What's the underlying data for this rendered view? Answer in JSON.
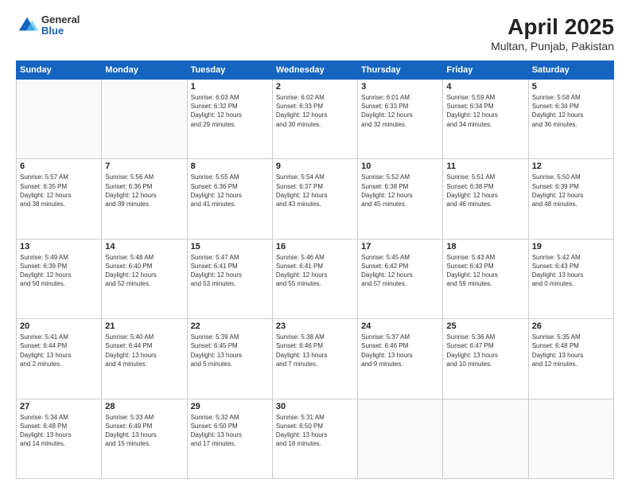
{
  "header": {
    "logo_general": "General",
    "logo_blue": "Blue",
    "title": "April 2025",
    "subtitle": "Multan, Punjab, Pakistan"
  },
  "calendar": {
    "days_of_week": [
      "Sunday",
      "Monday",
      "Tuesday",
      "Wednesday",
      "Thursday",
      "Friday",
      "Saturday"
    ],
    "weeks": [
      [
        {
          "day": "",
          "info": ""
        },
        {
          "day": "",
          "info": ""
        },
        {
          "day": "1",
          "info": "Sunrise: 6:03 AM\nSunset: 6:32 PM\nDaylight: 12 hours\nand 29 minutes."
        },
        {
          "day": "2",
          "info": "Sunrise: 6:02 AM\nSunset: 6:33 PM\nDaylight: 12 hours\nand 30 minutes."
        },
        {
          "day": "3",
          "info": "Sunrise: 6:01 AM\nSunset: 6:33 PM\nDaylight: 12 hours\nand 32 minutes."
        },
        {
          "day": "4",
          "info": "Sunrise: 5:59 AM\nSunset: 6:34 PM\nDaylight: 12 hours\nand 34 minutes."
        },
        {
          "day": "5",
          "info": "Sunrise: 5:58 AM\nSunset: 6:34 PM\nDaylight: 12 hours\nand 36 minutes."
        }
      ],
      [
        {
          "day": "6",
          "info": "Sunrise: 5:57 AM\nSunset: 6:35 PM\nDaylight: 12 hours\nand 38 minutes."
        },
        {
          "day": "7",
          "info": "Sunrise: 5:56 AM\nSunset: 6:36 PM\nDaylight: 12 hours\nand 39 minutes."
        },
        {
          "day": "8",
          "info": "Sunrise: 5:55 AM\nSunset: 6:36 PM\nDaylight: 12 hours\nand 41 minutes."
        },
        {
          "day": "9",
          "info": "Sunrise: 5:54 AM\nSunset: 6:37 PM\nDaylight: 12 hours\nand 43 minutes."
        },
        {
          "day": "10",
          "info": "Sunrise: 5:52 AM\nSunset: 6:38 PM\nDaylight: 12 hours\nand 45 minutes."
        },
        {
          "day": "11",
          "info": "Sunrise: 5:51 AM\nSunset: 6:38 PM\nDaylight: 12 hours\nand 46 minutes."
        },
        {
          "day": "12",
          "info": "Sunrise: 5:50 AM\nSunset: 6:39 PM\nDaylight: 12 hours\nand 48 minutes."
        }
      ],
      [
        {
          "day": "13",
          "info": "Sunrise: 5:49 AM\nSunset: 6:39 PM\nDaylight: 12 hours\nand 50 minutes."
        },
        {
          "day": "14",
          "info": "Sunrise: 5:48 AM\nSunset: 6:40 PM\nDaylight: 12 hours\nand 52 minutes."
        },
        {
          "day": "15",
          "info": "Sunrise: 5:47 AM\nSunset: 6:41 PM\nDaylight: 12 hours\nand 53 minutes."
        },
        {
          "day": "16",
          "info": "Sunrise: 5:46 AM\nSunset: 6:41 PM\nDaylight: 12 hours\nand 55 minutes."
        },
        {
          "day": "17",
          "info": "Sunrise: 5:45 AM\nSunset: 6:42 PM\nDaylight: 12 hours\nand 57 minutes."
        },
        {
          "day": "18",
          "info": "Sunrise: 5:43 AM\nSunset: 6:43 PM\nDaylight: 12 hours\nand 59 minutes."
        },
        {
          "day": "19",
          "info": "Sunrise: 5:42 AM\nSunset: 6:43 PM\nDaylight: 13 hours\nand 0 minutes."
        }
      ],
      [
        {
          "day": "20",
          "info": "Sunrise: 5:41 AM\nSunset: 6:44 PM\nDaylight: 13 hours\nand 2 minutes."
        },
        {
          "day": "21",
          "info": "Sunrise: 5:40 AM\nSunset: 6:44 PM\nDaylight: 13 hours\nand 4 minutes."
        },
        {
          "day": "22",
          "info": "Sunrise: 5:39 AM\nSunset: 6:45 PM\nDaylight: 13 hours\nand 5 minutes."
        },
        {
          "day": "23",
          "info": "Sunrise: 5:38 AM\nSunset: 6:46 PM\nDaylight: 13 hours\nand 7 minutes."
        },
        {
          "day": "24",
          "info": "Sunrise: 5:37 AM\nSunset: 6:46 PM\nDaylight: 13 hours\nand 9 minutes."
        },
        {
          "day": "25",
          "info": "Sunrise: 5:36 AM\nSunset: 6:47 PM\nDaylight: 13 hours\nand 10 minutes."
        },
        {
          "day": "26",
          "info": "Sunrise: 5:35 AM\nSunset: 6:48 PM\nDaylight: 13 hours\nand 12 minutes."
        }
      ],
      [
        {
          "day": "27",
          "info": "Sunrise: 5:34 AM\nSunset: 6:48 PM\nDaylight: 13 hours\nand 14 minutes."
        },
        {
          "day": "28",
          "info": "Sunrise: 5:33 AM\nSunset: 6:49 PM\nDaylight: 13 hours\nand 15 minutes."
        },
        {
          "day": "29",
          "info": "Sunrise: 5:32 AM\nSunset: 6:50 PM\nDaylight: 13 hours\nand 17 minutes."
        },
        {
          "day": "30",
          "info": "Sunrise: 5:31 AM\nSunset: 6:50 PM\nDaylight: 13 hours\nand 18 minutes."
        },
        {
          "day": "",
          "info": ""
        },
        {
          "day": "",
          "info": ""
        },
        {
          "day": "",
          "info": ""
        }
      ]
    ]
  }
}
